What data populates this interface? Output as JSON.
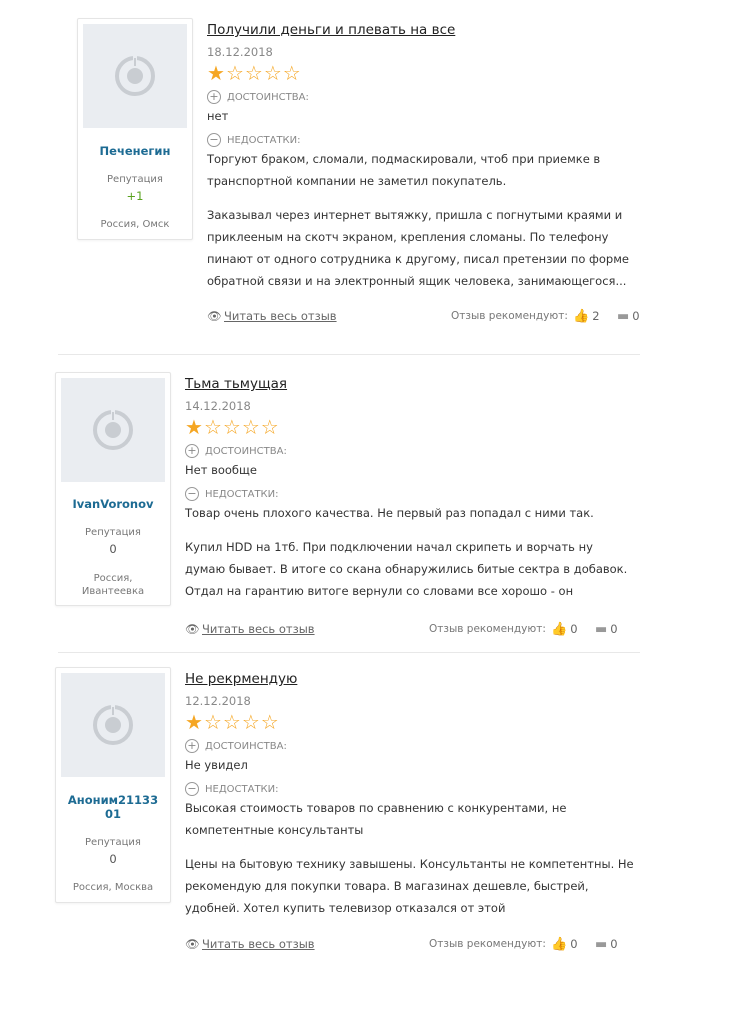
{
  "reviews": [
    {
      "title": "Получили деньги и плевать на все",
      "date": "18.12.2018",
      "rating": 1,
      "pros_label": "ДОСТОИНСТВА:",
      "pros": "нет",
      "cons_label": "НЕДОСТАТКИ:",
      "cons": [
        "Торгуют браком, сломали, подмаскировали, чтоб при приемке в",
        "транспортной компании не заметил покупатель."
      ],
      "body": [
        "Заказывал через интернет вытяжку, пришла с погнутыми краями и",
        "приклееным на скотч экраном, крепления сломаны. По телефону",
        "пинают от одного сотрудника к другому, писал претензии по форме",
        "обратной связи и на электронный ящик человека, занимающегося..."
      ],
      "read_more": "Читать весь отзыв",
      "recommend_label": "Отзыв рекомендуют:",
      "likes": "2",
      "comments": "0",
      "user": {
        "name": "Печенегин",
        "reputation_label": "Репутация",
        "reputation": "+1",
        "location": "Россия, Омск"
      }
    },
    {
      "title": "Тьма тьмущая",
      "date": "14.12.2018",
      "rating": 1,
      "pros_label": "ДОСТОИНСТВА:",
      "pros": "Нет вообще",
      "cons_label": "НЕДОСТАТКИ:",
      "cons": [
        "Товар очень плохого качества. Не первый раз попадал с ними так."
      ],
      "body": [
        "Купил HDD на 1тб. При подключении начал скрипеть и ворчать ну",
        "думаю бывает. В итоге со скана обнаружились битые сектра в добавок.",
        "Отдал на гарантию витоге вернули со словами все хорошо - он"
      ],
      "read_more": "Читать весь отзыв",
      "recommend_label": "Отзыв рекомендуют:",
      "likes": "0",
      "comments": "0",
      "user": {
        "name": "IvanVoronov",
        "reputation_label": "Репутация",
        "reputation": "0",
        "location": "Россия, Ивантеевка"
      }
    },
    {
      "title": "Не рекрмендую",
      "date": "12.12.2018",
      "rating": 1,
      "pros_label": "ДОСТОИНСТВА:",
      "pros": "Не увидел",
      "cons_label": "НЕДОСТАТКИ:",
      "cons": [
        "Высокая стоимость товаров по сравнению с конкурентами, не",
        "компетентные консультанты"
      ],
      "body": [
        "Цены на бытовую технику завышены. Консультанты не компетентны. Не",
        "рекомендую для покупки товара. В магазинах дешевле, быстрей,",
        "удобней. Хотел купить телевизор отказался от этой"
      ],
      "read_more": "Читать весь отзыв",
      "recommend_label": "Отзыв рекомендуют:",
      "likes": "0",
      "comments": "0",
      "user": {
        "name": "Аноним2113301",
        "reputation_label": "Репутация",
        "reputation": "0",
        "location": "Россия, Москва"
      }
    }
  ],
  "icons": {
    "avatar": "avatar-placeholder-icon",
    "plus": "plus-circle-icon",
    "minus": "minus-circle-icon",
    "eye": "eye-icon",
    "like": "thumbs-up-icon",
    "comment": "comment-icon",
    "star": "star-icon"
  },
  "colors": {
    "star": "#f5a623",
    "username": "#1d6b93",
    "reputation_positive": "#5aa21e"
  }
}
